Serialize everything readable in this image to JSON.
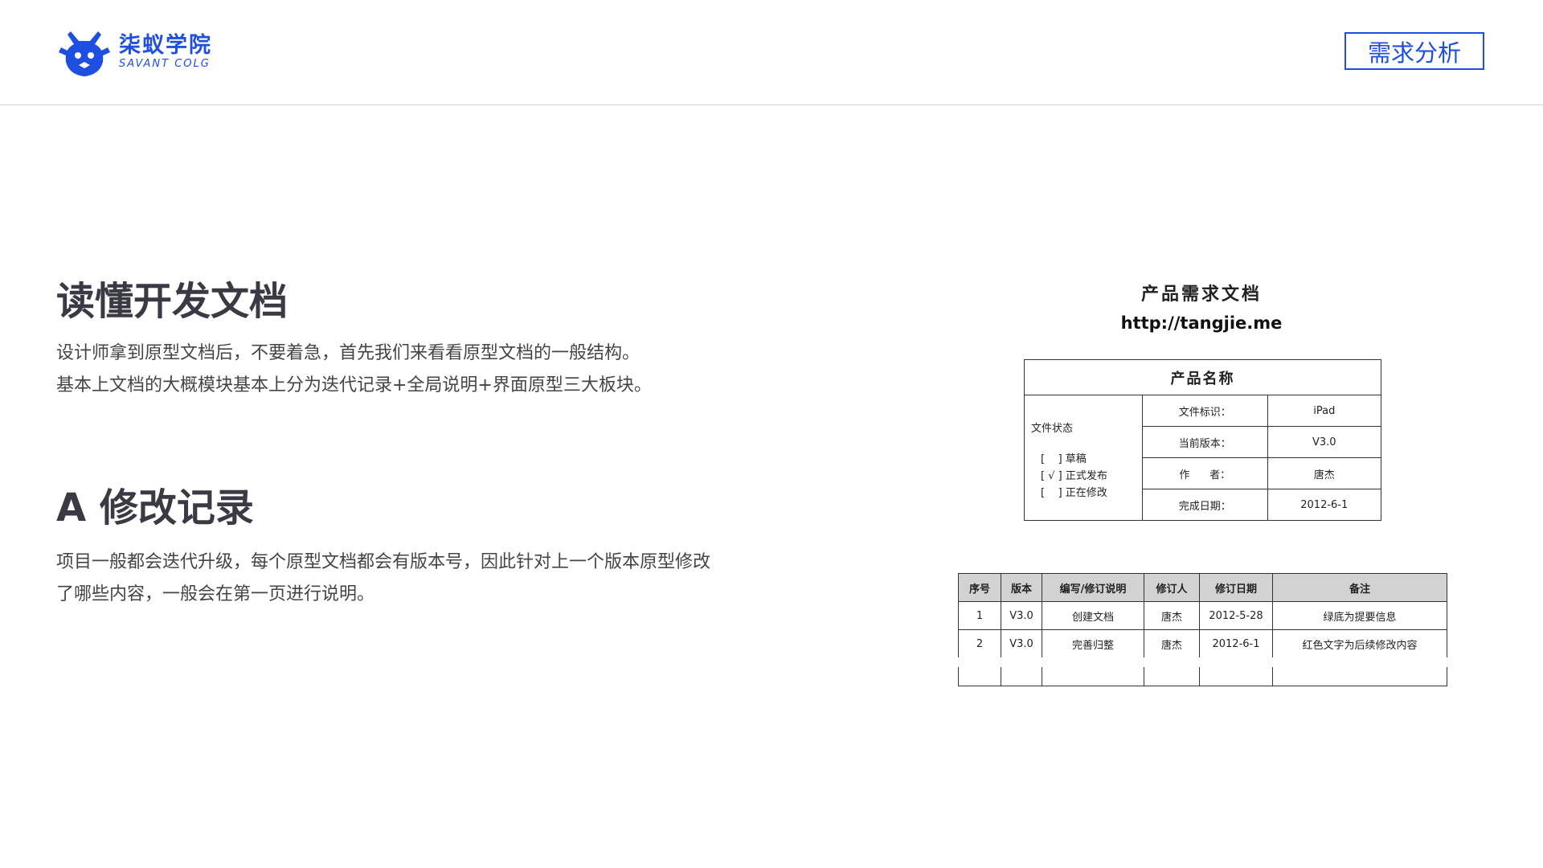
{
  "header": {
    "logo_cn": "柒蚁学院",
    "logo_en": "SAVANT COLG",
    "section_tag": "需求分析",
    "brand_color": "#1f4fe0"
  },
  "main": {
    "heading1": "读懂开发文档",
    "para1_line1": "设计师拿到原型文档后，不要着急，首先我们来看看原型文档的一般结构。",
    "para1_line2": "基本上文档的大概模块基本上分为迭代记录+全局说明+界面原型三大板块。",
    "heading2": "A 修改记录",
    "para2_line1": "项目一般都会迭代升级，每个原型文档都会有版本号，因此针对上一个版本原型修改",
    "para2_line2": "了哪些内容，一般会在第一页进行说明。"
  },
  "document": {
    "title": "产品需求文档",
    "url": "http://tangjie.me",
    "info_table": {
      "header": "产品名称",
      "status_label": "文件状态",
      "status_options": [
        "[    ] 草稿",
        "[ √ ] 正式发布",
        "[    ] 正在修改"
      ],
      "rows": [
        {
          "label": "文件标识：",
          "value": "iPad"
        },
        {
          "label": "当前版本：",
          "value": "V3.0"
        },
        {
          "label": "作      者：",
          "value": "唐杰"
        },
        {
          "label": "完成日期：",
          "value": "2012-6-1"
        }
      ]
    },
    "revision_table": {
      "headers": [
        "序号",
        "版本",
        "编写/修订说明",
        "修订人",
        "修订日期",
        "备注"
      ],
      "rows": [
        [
          "1",
          "V3.0",
          "创建文档",
          "唐杰",
          "2012-5-28",
          "绿底为提要信息"
        ],
        [
          "2",
          "V3.0",
          "完善归整",
          "唐杰",
          "2012-6-1",
          "红色文字为后续修改内容"
        ]
      ]
    }
  }
}
